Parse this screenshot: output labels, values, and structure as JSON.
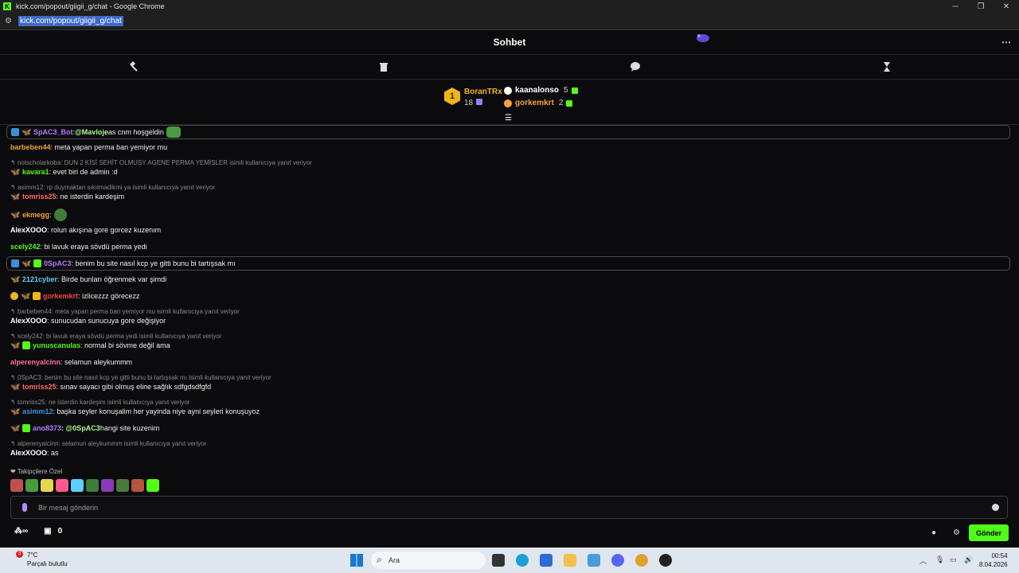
{
  "window": {
    "title": "kick.com/popout/giigii_g/chat - Google Chrome",
    "url": "kick.com/popout/giigii_g/chat"
  },
  "header": {
    "title": "Sohbet",
    "more_label": "⋯"
  },
  "leaderboard": {
    "first": {
      "rank": "1",
      "name": "BoranTRx",
      "count": "18"
    },
    "others": [
      {
        "name": "kaanalonso",
        "count": "5",
        "color": "#ffffff"
      },
      {
        "name": "gorkemkrt",
        "count": "2",
        "color": "#f2a33a"
      }
    ]
  },
  "messages": [
    {
      "user": "SpAC3_Bot",
      "color": "#b57bff",
      "text": " as cnm hoşgeldin",
      "mention": "@Mavloje",
      "pinned": true
    },
    {
      "user": "barbeben44",
      "color": "#f2a33a",
      "text": ": meta yapan perma ban yemiyor mu"
    },
    {
      "reply": "notscholarkoba: DUN 2 KİSİ SEHİT OLMUSY AGENE PERMA YEMİSLER isimli kullanıcıya yanıt veriyor",
      "user": "kavara1",
      "color": "#53fc18",
      "text": ": evet biri de admin :d"
    },
    {
      "reply": "asimm12: rp duymaktan sıkılmadikmi ya isimli kullanıcıya yanıt veriyor",
      "user": "tomriss25",
      "color": "#ff6b6b",
      "text": ": ne isterdin kardeşim"
    },
    {
      "user": "ekmegg",
      "color": "#f2a33a",
      "text": ":"
    },
    {
      "user": "AlexXOOO",
      "color": "#ffffff",
      "text": ": rolun akışına gore gorcez kuzenım"
    },
    {
      "user": "scely242",
      "color": "#53fc18",
      "text": ": bi lavuk eraya sövdü perma yedi"
    },
    {
      "user": "0SpAC3",
      "color": "#b57bff",
      "text": ": benim bu site nasıl kcp ye gitti bunu bi tartışsak mı",
      "pinned": true
    },
    {
      "user": "2121cyber",
      "color": "#5ad1ff",
      "text": ": Birde bunları öğrenmek var şimdi"
    },
    {
      "user": "gorkemkrt",
      "color": "#ff4040",
      "text": ": izlicezzz görecezz"
    },
    {
      "reply": "barbeben44: meta yapan perma ban yemiyor mu isimli kullanıcıya yanıt veriyor",
      "user": "AlexXOOO",
      "color": "#ffffff",
      "text": ": sunucudan sunucuya gore değişiyor"
    },
    {
      "reply": "scely242: bi lavuk eraya sövdü perma yedi isimli kullanıcıya yanıt veriyor",
      "user": "yunuscanulas",
      "color": "#53fc18",
      "text": ": normal bi sövme değil ama"
    },
    {
      "user": "alperenyalcinn",
      "color": "#ff6b9e",
      "text": ": selamun aleykummm"
    },
    {
      "reply": "0SpAC3: benim bu site nasıl kcp ye gitti bunu bi tartışsak mı isimli kullanıcıya yanıt veriyor",
      "user": "tomriss25",
      "color": "#ff6b6b",
      "text": ": sınav sayacı gibi olmuş eline sağlık sdfgdsdfgfd"
    },
    {
      "reply": "tomriss25: ne isterdin kardeşim isimli kullanıcıya yanıt veriyor",
      "user": "asimm12",
      "color": "#3a8fd8",
      "text": ": başka seyler konuşalim her yayinda niye ayni seyleri konuşuyoz"
    },
    {
      "user": "ano8373",
      "color": "#b57bff",
      "text": " hangi site kuzenim",
      "mention": ": @0SpAC3"
    },
    {
      "reply": "alperenyalcinn: selamun aleykummm isimli kullanıcıya yanıt veriyor",
      "user": "AlexXOOO",
      "color": "#ffffff",
      "text": ": as"
    }
  ],
  "followers_label": "❤ Takipçilere Özel",
  "input": {
    "placeholder": "Bir mesaj gönderin"
  },
  "bottom": {
    "points": "0",
    "send_label": "Gönder"
  },
  "taskbar": {
    "temp": "7°C",
    "weather": "Parçalı bulutlu",
    "weather_badge": "3",
    "search_label": "Ara",
    "time": "00:54",
    "date": "8.04.2026"
  }
}
